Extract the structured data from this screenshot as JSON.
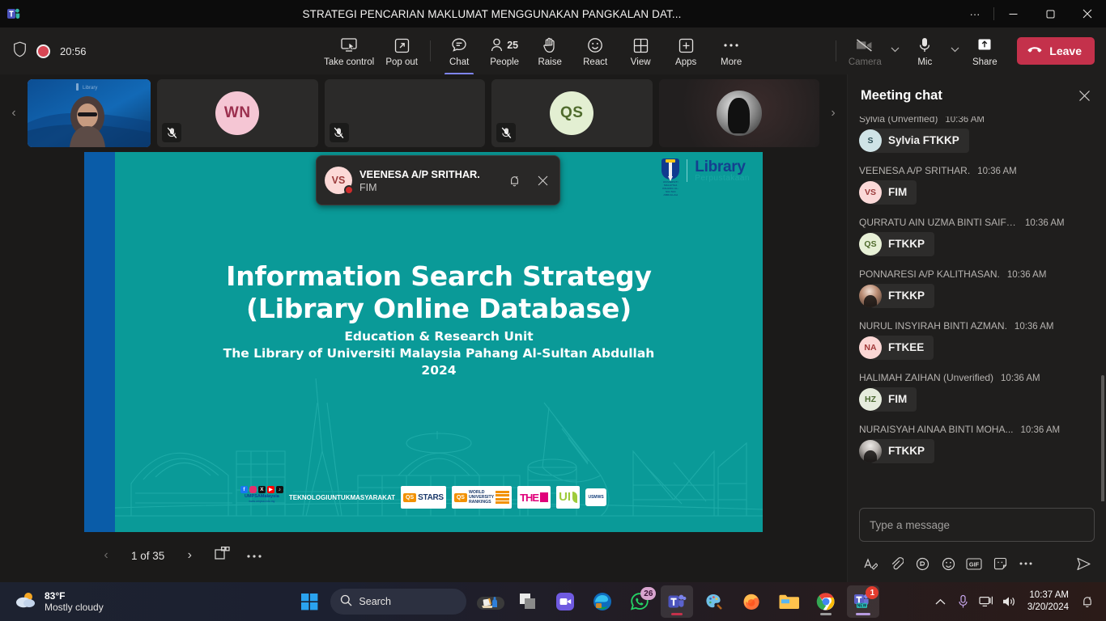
{
  "titlebar": {
    "title": "STRATEGI PENCARIAN MAKLUMAT MENGGUNAKAN PANGKALAN DAT...",
    "more_label": "···",
    "minimize_label": "─",
    "maximize_label": "❐",
    "close_label": "✕"
  },
  "toolbar": {
    "recording_time": "20:56",
    "items": [
      {
        "label": "Take control",
        "icon": "take-control-icon"
      },
      {
        "label": "Pop out",
        "icon": "pop-out-icon"
      },
      {
        "label": "Chat",
        "icon": "chat-icon",
        "active": true
      },
      {
        "label": "People",
        "icon": "people-icon",
        "count": "25"
      },
      {
        "label": "Raise",
        "icon": "raise-hand-icon"
      },
      {
        "label": "React",
        "icon": "react-icon"
      },
      {
        "label": "View",
        "icon": "view-grid-icon"
      },
      {
        "label": "Apps",
        "icon": "apps-icon"
      },
      {
        "label": "More",
        "icon": "more-ellipsis-icon"
      }
    ],
    "camera_label": "Camera",
    "mic_label": "Mic",
    "share_label": "Share",
    "leave_label": "Leave"
  },
  "filmstrip": {
    "prev_label": "‹",
    "next_label": "›",
    "tiles": [
      {
        "type": "video",
        "name": "presenter-video",
        "initials": ""
      },
      {
        "type": "avatar",
        "name": "WN",
        "initials": "WN",
        "bg": "#f5c6d4",
        "fg": "#9b2f4e",
        "muted": true
      },
      {
        "type": "avatar",
        "name": "hidden-1",
        "initials": "",
        "bg": "#2b2a29",
        "fg": "#fff",
        "muted": true
      },
      {
        "type": "avatar",
        "name": "QS",
        "initials": "QS",
        "bg": "#e3efd2",
        "fg": "#4f6b2c",
        "muted": true
      },
      {
        "type": "photo",
        "name": "participant-photo",
        "initials": ""
      }
    ],
    "callout": {
      "name": "VEENESA A/P SRITHAR.",
      "sub": "FIM",
      "initials": "VS",
      "mute_notifications_icon": "bell-sleep-icon",
      "close_icon": "close-icon"
    }
  },
  "slide": {
    "title_line1": "Information Search Strategy",
    "title_line2": "(Library Online Database)",
    "sub_line1": "Education & Research Unit",
    "sub_line2": "The Library of Universiti Malaysia Pahang Al-Sultan Abdullah",
    "sub_line3": "2024",
    "logo_main": "Library",
    "logo_sub": "Perpustakaan",
    "crest_caption": "UNIVERSITI MALAYSIA PAHANG AL-SULTAN ABDULLAH",
    "background_color": "#0a9a98",
    "accent_bar_color": "#0a5ca8",
    "footer_logos": [
      {
        "name": "umps-social",
        "caption": "UMPSAMalaysia",
        "caption2": "www.umpsa.edu.my"
      },
      {
        "name": "teknologi-untuk-masyarakat",
        "l1": "TEKNOLOGI",
        "l2": "UNTUK",
        "l3": "MASYARAKAT"
      },
      {
        "name": "qs-stars",
        "mark": "QS",
        "text": "STARS"
      },
      {
        "name": "qs-world-university-rankings",
        "mark": "QS",
        "l1": "WORLD",
        "l2": "UNIVERSITY",
        "l3": "RANKINGS"
      },
      {
        "name": "the-rankings",
        "text": "THE"
      },
      {
        "name": "ui-greenmetric",
        "text": "UI"
      },
      {
        "name": "usmws-seal",
        "text": "USMWS"
      }
    ]
  },
  "slide_controls": {
    "prev_label": "‹",
    "counter": "1 of 35",
    "next_label": "›",
    "layout_icon": "slide-layout-icon",
    "more_icon": "more-ellipsis-icon"
  },
  "chat": {
    "title": "Meeting chat",
    "close_icon": "close-icon",
    "messages": [
      {
        "author": "Sylvia (Unverified)",
        "time": "10:36 AM",
        "text": "Sylvia FTKKP",
        "initials": "S",
        "bg": "#cfe3e6",
        "fg": "#2c4f55",
        "avatar": "initials"
      },
      {
        "author": "VEENESA A/P SRITHAR.",
        "time": "10:36 AM",
        "text": "FIM",
        "initials": "VS",
        "bg": "#fbd9d8",
        "fg": "#9b3b3b",
        "avatar": "initials"
      },
      {
        "author": "QURRATU AIN UZMA BINTI SAIFU...",
        "time": "10:36 AM",
        "text": "FTKKP",
        "initials": "QS",
        "bg": "#e7f0d6",
        "fg": "#4f6b2c",
        "avatar": "initials"
      },
      {
        "author": "PONNARESI A/P KALITHASAN.",
        "time": "10:36 AM",
        "text": "FTKKP",
        "initials": "",
        "bg": "",
        "fg": "",
        "avatar": "photo"
      },
      {
        "author": "NURUL INSYIRAH BINTI AZMAN.",
        "time": "10:36 AM",
        "text": "FTKEE",
        "initials": "NA",
        "bg": "#fbd7d5",
        "fg": "#a23a3a",
        "avatar": "initials"
      },
      {
        "author": "HALIMAH ZAIHAN (Unverified)",
        "time": "10:36 AM",
        "text": "FIM",
        "initials": "HZ",
        "bg": "#e6ecdd",
        "fg": "#4d6a33",
        "avatar": "initials"
      },
      {
        "author": "NURAISYAH AINAA BINTI MOHA...",
        "time": "10:36 AM",
        "text": "FTKKP",
        "initials": "",
        "bg": "",
        "fg": "",
        "avatar": "photo2"
      }
    ],
    "composer_placeholder": "Type a message",
    "tools": [
      {
        "name": "format-icon",
        "glyph": "𝑨"
      },
      {
        "name": "attach-icon",
        "glyph": "📎"
      },
      {
        "name": "loop-icon",
        "glyph": "Ⓟ"
      },
      {
        "name": "emoji-icon",
        "glyph": "☺"
      },
      {
        "name": "gif-icon",
        "glyph": "GIF"
      },
      {
        "name": "sticker-icon",
        "glyph": "❑"
      },
      {
        "name": "more-options-icon",
        "glyph": "···"
      },
      {
        "name": "send-icon",
        "glyph": "➤"
      }
    ]
  },
  "taskbar": {
    "weather_temp": "83°F",
    "weather_desc": "Mostly cloudy",
    "search_placeholder": "Search",
    "apps": [
      {
        "name": "widgets-pinned-icon",
        "badge": ""
      },
      {
        "name": "file-explorer-group-icon",
        "badge": ""
      },
      {
        "name": "zoom-icon",
        "badge": ""
      },
      {
        "name": "microsoft-edge-icon",
        "badge": ""
      },
      {
        "name": "whatsapp-icon",
        "badge": "26"
      },
      {
        "name": "microsoft-teams-classic-icon",
        "badge": ""
      },
      {
        "name": "paint-icon",
        "badge": ""
      },
      {
        "name": "firefox-icon",
        "badge": ""
      },
      {
        "name": "file-explorer-icon",
        "badge": ""
      },
      {
        "name": "google-chrome-icon",
        "badge": ""
      },
      {
        "name": "microsoft-teams-new-icon",
        "badge": "1"
      }
    ],
    "clock_time": "10:37 AM",
    "clock_date": "3/20/2024"
  }
}
